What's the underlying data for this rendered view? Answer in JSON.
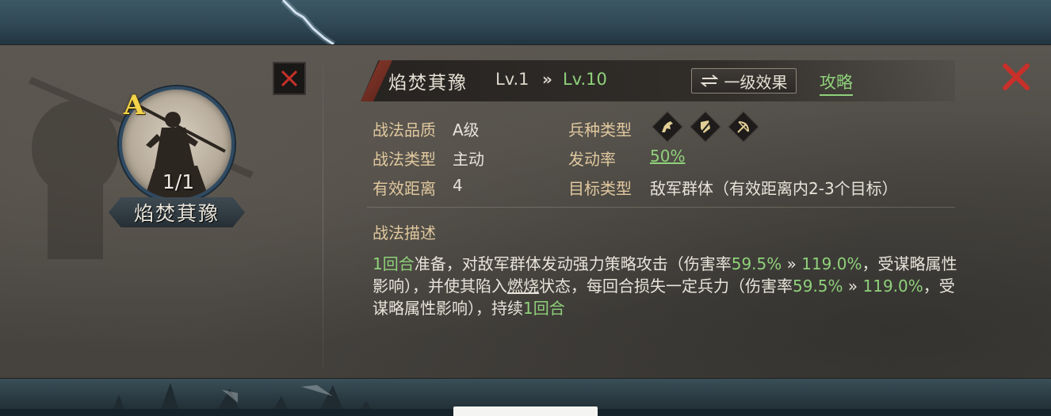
{
  "skill": {
    "name": "焰焚萁豫",
    "grade_letter": "A",
    "count": "1/1"
  },
  "header": {
    "title": "焰焚萁豫",
    "level_from": "Lv.1",
    "level_arrow": "»",
    "level_to": "Lv.10",
    "effect_button_icon": "swap-arrows-icon",
    "effect_button_label": "一级效果",
    "guide_link": "攻略"
  },
  "info": {
    "quality_label": "战法品质",
    "quality_value": "A级",
    "type_label": "战法类型",
    "type_value": "主动",
    "range_label": "有效距离",
    "range_value": "4",
    "troop_label": "兵种类型",
    "troop_icons": [
      "cavalry-icon",
      "shield-icon",
      "bow-icon"
    ],
    "rate_label": "发动率",
    "rate_value": "50%",
    "target_label": "目标类型",
    "target_value": "敌军群体（有效距离内2-3个目标）"
  },
  "description": {
    "title": "战法描述",
    "parts": [
      {
        "text": "1回合",
        "style": "g"
      },
      {
        "text": "准备，对敌军群体发动强力策略攻击（伤害率",
        "style": ""
      },
      {
        "text": "59.5%",
        "style": "g"
      },
      {
        "text": " » ",
        "style": ""
      },
      {
        "text": "119.0%",
        "style": "g"
      },
      {
        "text": "，受谋略属性影响），并使其陷入",
        "style": ""
      },
      {
        "text": "燃烧",
        "style": "u"
      },
      {
        "text": "状态，每回合损失一定兵力（伤害率",
        "style": ""
      },
      {
        "text": "59.5%",
        "style": "g"
      },
      {
        "text": " » ",
        "style": ""
      },
      {
        "text": "119.0%",
        "style": "g"
      },
      {
        "text": "，受谋略属性影响），持续",
        "style": ""
      },
      {
        "text": "1回合",
        "style": "g"
      }
    ]
  },
  "colors": {
    "accent_green": "#8fd17a",
    "label_gold": "#e0c89e",
    "close_red": "#c8302a",
    "grade_yellow": "#f2d34a"
  }
}
